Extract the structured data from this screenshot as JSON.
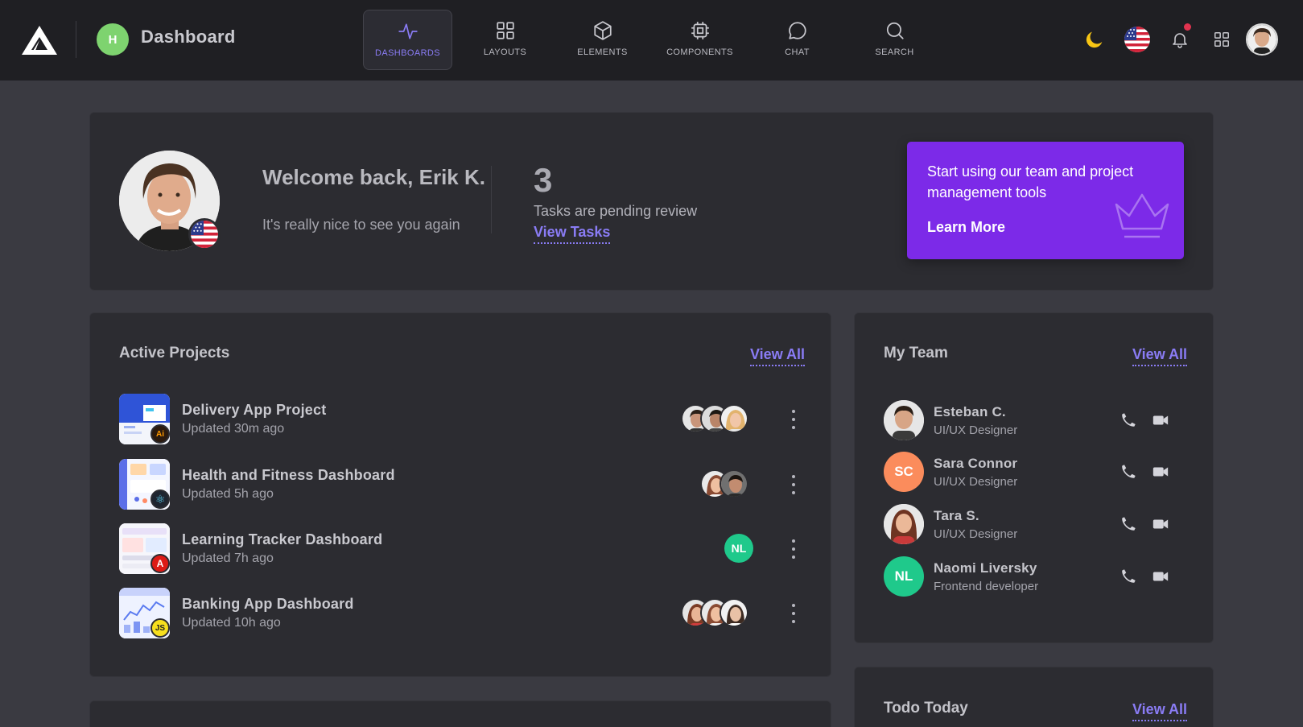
{
  "header": {
    "brand_initial": "H",
    "title": "Dashboard",
    "nav": [
      {
        "label": "DASHBOARDS",
        "icon": "activity-icon",
        "active": true
      },
      {
        "label": "LAYOUTS",
        "icon": "grid-icon",
        "active": false
      },
      {
        "label": "ELEMENTS",
        "icon": "cube-icon",
        "active": false
      },
      {
        "label": "COMPONENTS",
        "icon": "chip-icon",
        "active": false
      },
      {
        "label": "CHAT",
        "icon": "chat-icon",
        "active": false
      },
      {
        "label": "SEARCH",
        "icon": "search-icon",
        "active": false
      }
    ],
    "right_icons": [
      "moon-icon",
      "us-flag-icon",
      "bell-icon",
      "apps-grid-icon",
      "user-avatar"
    ]
  },
  "welcome": {
    "title": "Welcome back, Erik K.",
    "subtitle": "It's really nice to see you again",
    "pending_count": "3",
    "pending_text": "Tasks are pending review",
    "view_tasks": "View Tasks",
    "promo_text": "Start using our team and project management tools",
    "promo_link": "Learn More"
  },
  "projects": {
    "title": "Active Projects",
    "view_all": "View All",
    "items": [
      {
        "name": "Delivery App Project",
        "updated": "Updated 30m ago",
        "badge": "Ai",
        "badge_bg": "#2b1a0e",
        "badge_fg": "#ff9a00",
        "members": 3,
        "initials": ""
      },
      {
        "name": "Health and Fitness Dashboard",
        "updated": "Updated 5h ago",
        "badge": "⚛",
        "badge_bg": "#1f2530",
        "badge_fg": "#61dafb",
        "members": 2,
        "initials": ""
      },
      {
        "name": "Learning Tracker Dashboard",
        "updated": "Updated 7h ago",
        "badge": "A",
        "badge_bg": "#dd1b16",
        "badge_fg": "#ffffff",
        "members": 0,
        "initials": "NL"
      },
      {
        "name": "Banking App Dashboard",
        "updated": "Updated 10h ago",
        "badge": "JS",
        "badge_bg": "#f7df1e",
        "badge_fg": "#222222",
        "members": 3,
        "initials": ""
      }
    ]
  },
  "team": {
    "title": "My Team",
    "view_all": "View All",
    "members": [
      {
        "name": "Esteban C.",
        "role": "UI/UX Designer",
        "initials": "",
        "color": "#d9c4b0"
      },
      {
        "name": "Sara Connor",
        "role": "UI/UX Designer",
        "initials": "SC",
        "color": "#fb8c5c"
      },
      {
        "name": "Tara S.",
        "role": "UI/UX Designer",
        "initials": "",
        "color": "#c79a86"
      },
      {
        "name": "Naomi Liversky",
        "role": "Frontend developer",
        "initials": "NL",
        "color": "#1fc98b"
      }
    ]
  },
  "todo": {
    "title": "Todo Today",
    "view_all": "View All"
  },
  "colors": {
    "accent": "#8a7cf5",
    "promo": "#7c2ae8",
    "navbar": "#1f1f23",
    "background": "#3a3a41",
    "card": "#2c2c31"
  }
}
